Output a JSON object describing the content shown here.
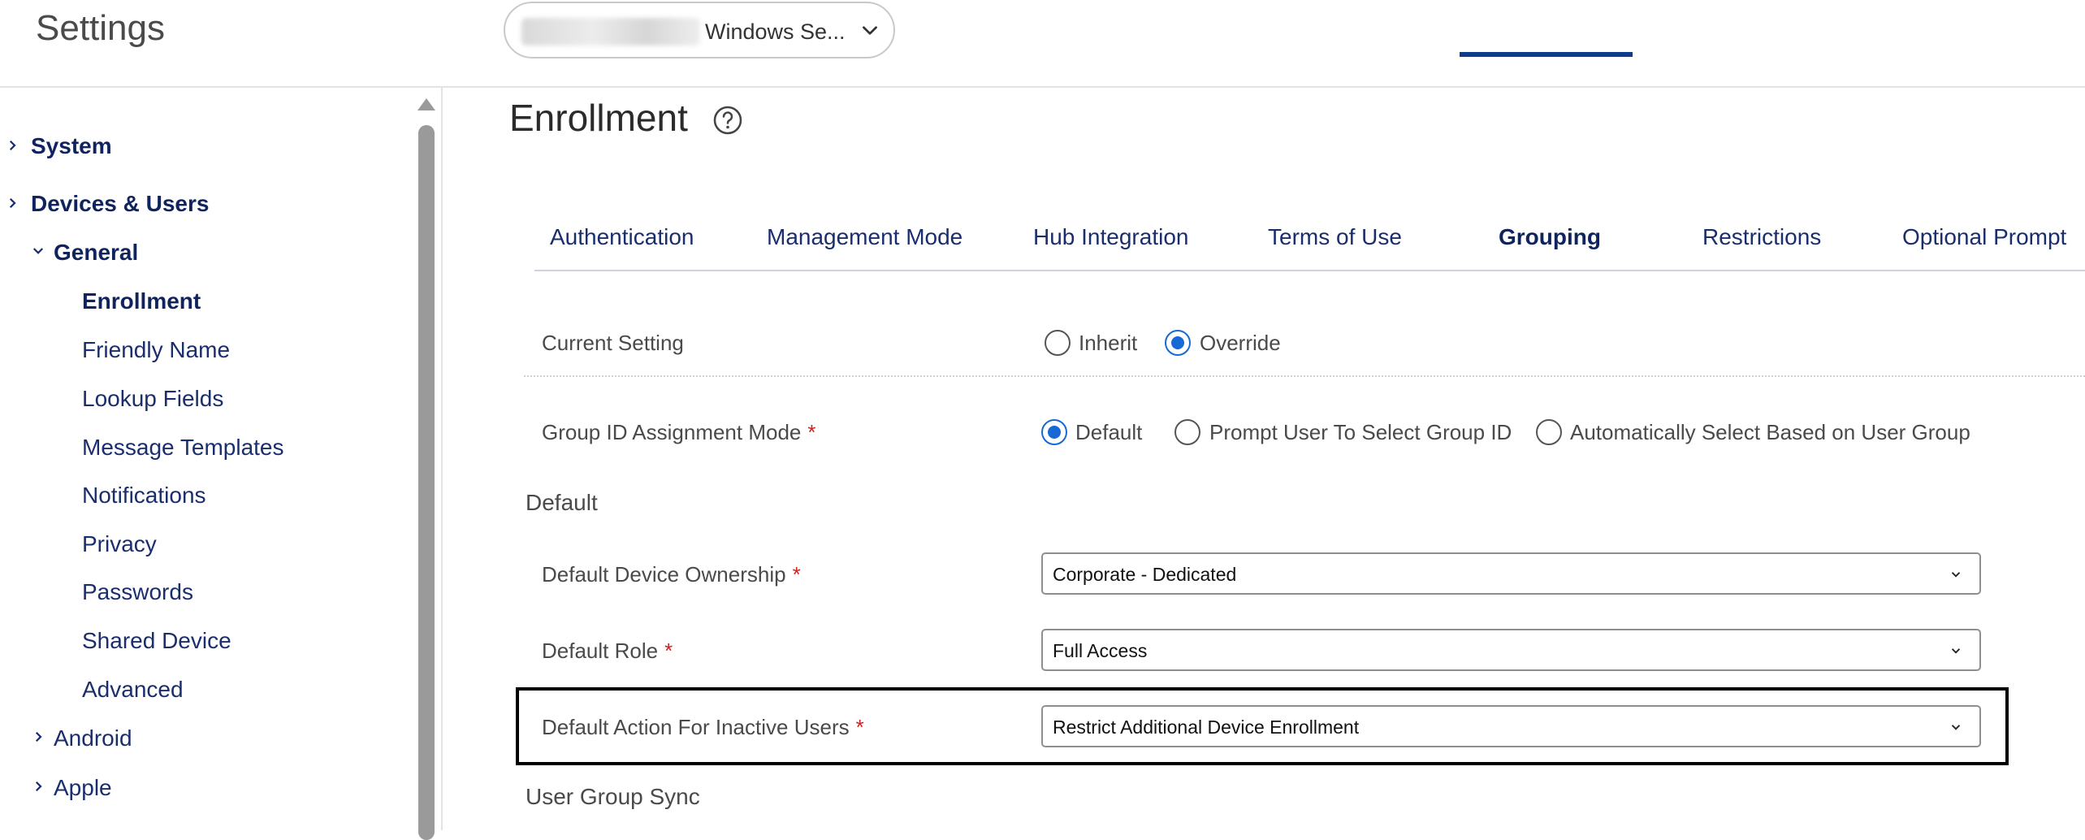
{
  "header": {
    "app_title": "Settings",
    "org_selector_label": "Windows Se..."
  },
  "sidebar": {
    "items": [
      {
        "label": "System"
      },
      {
        "label": "Devices & Users"
      },
      {
        "label": "General"
      },
      {
        "label": "Enrollment"
      },
      {
        "label": "Friendly Name"
      },
      {
        "label": "Lookup Fields"
      },
      {
        "label": "Message Templates"
      },
      {
        "label": "Notifications"
      },
      {
        "label": "Privacy"
      },
      {
        "label": "Passwords"
      },
      {
        "label": "Shared Device"
      },
      {
        "label": "Advanced"
      },
      {
        "label": "Android"
      },
      {
        "label": "Apple"
      }
    ]
  },
  "main": {
    "page_title": "Enrollment",
    "tabs": [
      {
        "label": "Authentication"
      },
      {
        "label": "Management Mode"
      },
      {
        "label": "Hub Integration"
      },
      {
        "label": "Terms of Use"
      },
      {
        "label": "Grouping"
      },
      {
        "label": "Restrictions"
      },
      {
        "label": "Optional Prompt"
      }
    ],
    "current_setting": {
      "label": "Current Setting",
      "options": [
        "Inherit",
        "Override"
      ],
      "selected": "Override"
    },
    "group_id_mode": {
      "label": "Group ID Assignment Mode",
      "required_mark": "*",
      "options": [
        "Default",
        "Prompt User To Select Group ID",
        "Automatically Select Based on User Group"
      ],
      "selected": "Default"
    },
    "default_section": {
      "title": "Default",
      "fields": [
        {
          "label": "Default Device Ownership",
          "required_mark": "*",
          "value": "Corporate - Dedicated"
        },
        {
          "label": "Default Role",
          "required_mark": "*",
          "value": "Full Access"
        },
        {
          "label": "Default Action For Inactive Users",
          "required_mark": "*",
          "value": "Restrict Additional Device Enrollment"
        }
      ]
    },
    "user_group_sync_title": "User Group Sync"
  },
  "colors": {
    "nav_text": "#1a2e6e",
    "accent_blue": "#1769d6",
    "tab_underline": "#0f3c8a",
    "required": "#d02020"
  }
}
